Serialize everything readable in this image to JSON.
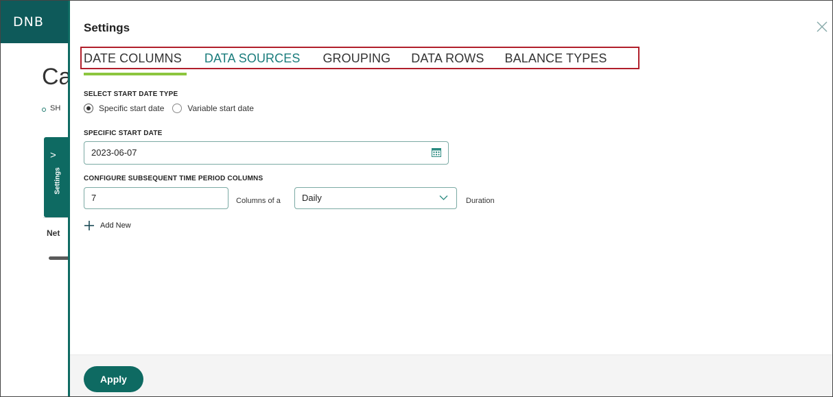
{
  "app": {
    "logo": "DNB",
    "bg_title": "Ca",
    "bg_sh": "SH",
    "bg_tab_label": "Settings",
    "bg_tab_arrow": ">",
    "bg_net": "Net"
  },
  "panel": {
    "title": "Settings",
    "close_icon": "close-icon"
  },
  "tabs": [
    {
      "label": "DATE COLUMNS",
      "active": true
    },
    {
      "label": "DATA SOURCES",
      "active": false
    },
    {
      "label": "GROUPING",
      "active": false
    },
    {
      "label": "DATA ROWS",
      "active": false
    },
    {
      "label": "BALANCE TYPES",
      "active": false
    }
  ],
  "start_type": {
    "label": "SELECT START DATE TYPE",
    "options": [
      {
        "label": "Specific start date",
        "selected": true
      },
      {
        "label": "Variable start date",
        "selected": false
      }
    ]
  },
  "specific_date": {
    "label": "SPECIFIC START DATE",
    "value": "2023-06-07"
  },
  "periods": {
    "label": "CONFIGURE SUBSEQUENT TIME PERIOD COLUMNS",
    "count": "7",
    "columns_of": "Columns of a",
    "frequency": "Daily",
    "duration": "Duration",
    "add_new": "Add New"
  },
  "footer": {
    "apply": "Apply"
  },
  "colors": {
    "brand": "#0e6a62",
    "tab_active_underline": "#8cc63f",
    "highlight_box": "#b01e2a",
    "tab_link": "#1a7c7c"
  }
}
